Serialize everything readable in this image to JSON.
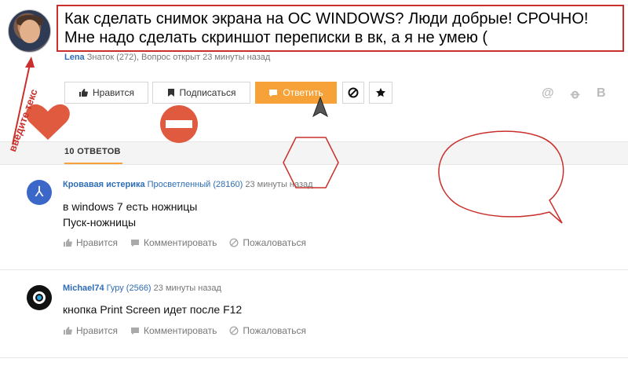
{
  "question": {
    "title": "Как сделать снимок экрана на ОС WINDOWS? Люди добрые! СРОЧНО! Мне надо сделать скриншот переписки в вк, а я не умею (",
    "author": "Lena",
    "meta": " Знаток (272), Вопрос открыт 23 минуты назад"
  },
  "actions": {
    "like": "Нравится",
    "subscribe": "Подписаться",
    "answer": "Ответить"
  },
  "tabs": {
    "answers": "10 ОТВЕТОВ"
  },
  "annotation": {
    "vertical_text": "введите текс"
  },
  "answers": [
    {
      "author": "Кровавая истерика",
      "rank": " Просветленный (28160)",
      "time": " 23 минуты назад",
      "text_line1": "в windows 7 есть ножницы",
      "text_line2": "Пуск-ножницы",
      "like": "Нравится",
      "comment": "Комментировать",
      "report": "Пожаловаться"
    },
    {
      "author": "Michael74",
      "rank": " Гуру (2566)",
      "time": " 23 минуты назад",
      "text_line1": "кнопка Print Screen идет после F12",
      "like": "Нравится",
      "comment": "Комментировать",
      "report": "Пожаловаться"
    }
  ],
  "colors": {
    "accent": "#f7a238",
    "link": "#2f6db5",
    "annotation_red": "#c9302c",
    "heart": "#e05a40",
    "no_entry": "#e05a40"
  }
}
